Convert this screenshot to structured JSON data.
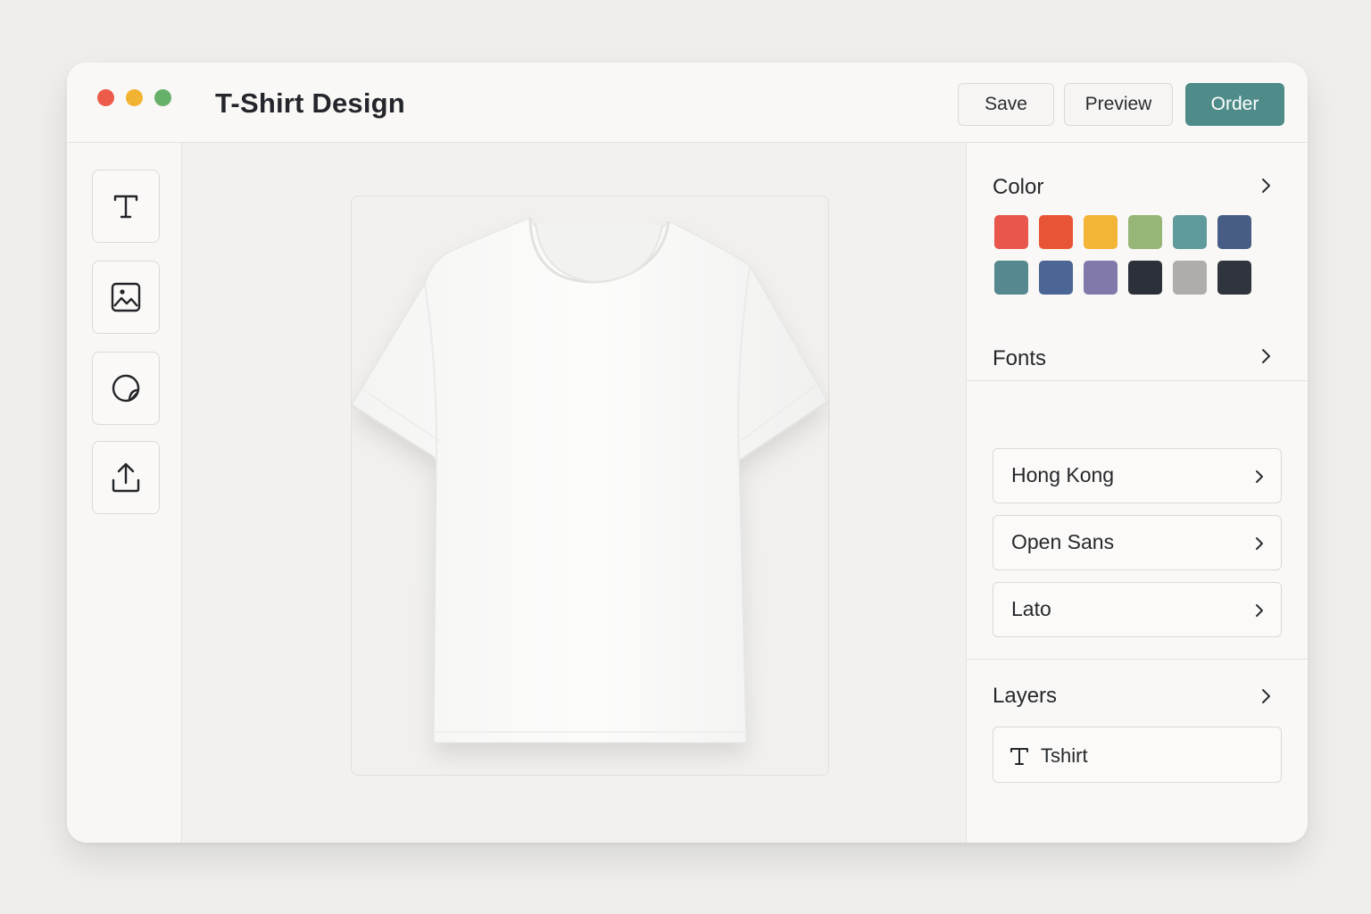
{
  "window": {
    "title": "T-Shirt Design"
  },
  "toolbar": {
    "save_label": "Save",
    "preview_label": "Preview",
    "order_label": "Order",
    "order_color": "#4f8c89"
  },
  "tools": [
    {
      "name": "text-tool",
      "icon": "text-icon"
    },
    {
      "name": "image-tool",
      "icon": "image-icon"
    },
    {
      "name": "sticker-tool",
      "icon": "sticker-icon"
    },
    {
      "name": "upload-tool",
      "icon": "upload-icon"
    }
  ],
  "canvas": {
    "product": "white t-shirt",
    "product_icon": "tshirt-image"
  },
  "sidebar": {
    "color": {
      "title": "Color",
      "swatches": [
        "#e8564c",
        "#e85536",
        "#f2b535",
        "#95b676",
        "#5f9a9c",
        "#485d86",
        "#55898f",
        "#4b6594",
        "#8179aa",
        "#2c3038",
        "#aeadac",
        "#30353d"
      ]
    },
    "fonts": {
      "title": "Fonts",
      "items": [
        {
          "label": "Hong Kong"
        },
        {
          "label": "Open Sans"
        },
        {
          "label": "Lato"
        }
      ]
    },
    "layers": {
      "title": "Layers",
      "items": [
        {
          "label": "Tshirt",
          "icon": "text-icon"
        }
      ]
    }
  }
}
